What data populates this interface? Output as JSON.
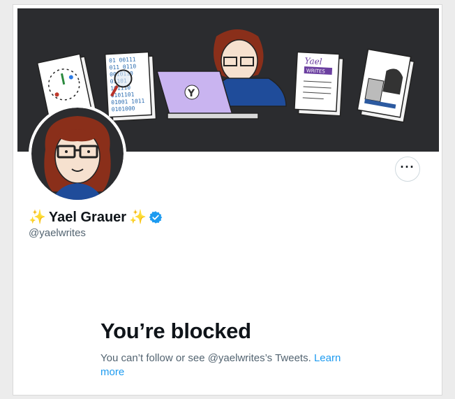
{
  "profile": {
    "display_name": "Yael Grauer",
    "name_prefix_emoji": "✨",
    "name_suffix_emoji": "✨",
    "handle": "@yaelwrites",
    "verified": true
  },
  "banner": {
    "paper_title": "Yael",
    "paper_subtitle": "WRITES",
    "binary_lines": [
      "01 00111",
      "011 0110",
      "0010110",
      "01101",
      "101110",
      "0101101",
      "01001 1011",
      "0101000"
    ]
  },
  "header": {
    "more_icon": "ellipsis-icon"
  },
  "blocked": {
    "title": "You’re blocked",
    "message": "You can’t follow or see @yaelwrites’s Tweets.",
    "link_label": "Learn more"
  },
  "colors": {
    "banner_bg": "#2b2c2f",
    "accent": "#1d9bf0",
    "text_primary": "#0f1419",
    "text_secondary": "#536471"
  }
}
